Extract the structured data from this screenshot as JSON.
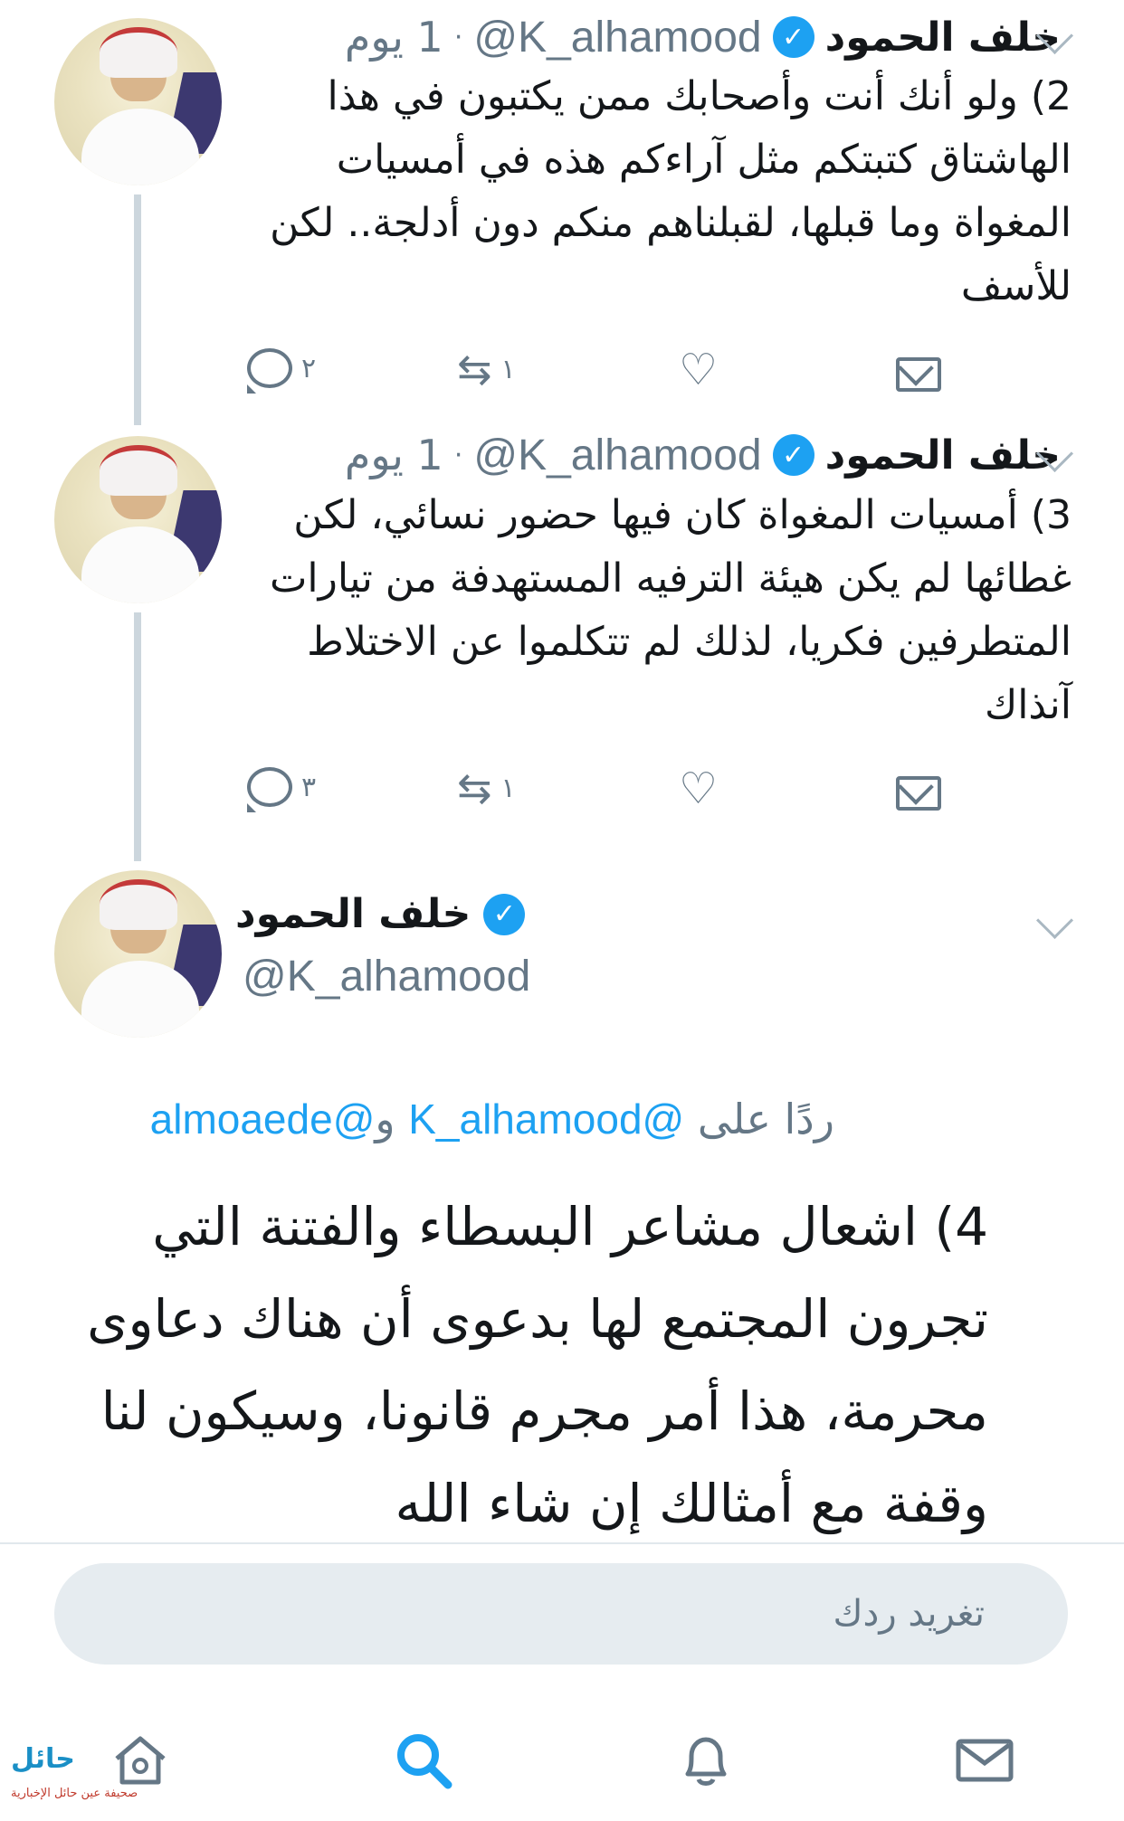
{
  "tweets": [
    {
      "name": "خلف الحمود",
      "handle": "@K_alhamood",
      "time": "1 يوم",
      "text": "2) ولو أنك أنت وأصحابك ممن يكتبون في هذا الهاشتاق كتبتكم مثل آراءكم هذه في أمسيات المغواة وما قبلها، لقبلناهم منكم دون أدلجة.. لكن للأسف",
      "replies": "٢",
      "retweets": "١"
    },
    {
      "name": "خلف الحمود",
      "handle": "@K_alhamood",
      "time": "1 يوم",
      "text": "3) أمسيات المغواة كان فيها حضور نسائي، لكن غطائها لم يكن هيئة الترفيه المستهدفة من تيارات المتطرفين فكريا، لذلك لم تتكلموا عن الاختلاط آنذاك",
      "replies": "٣",
      "retweets": "١"
    }
  ],
  "main_tweet": {
    "name": "خلف الحمود",
    "handle": "@K_alhamood",
    "replying_prefix": "ردًا على",
    "mention1": "@K_alhamood",
    "connector": "و",
    "mention2": "@almoaede",
    "text": "4) اشعال مشاعر البسطاء والفتنة التي تجرون المجتمع لها بدعوى أن هناك دعاوى محرمة، هذا أمر مجرم قانونا، وسيكون لنا وقفة مع أمثالك إن شاء الله"
  },
  "reply_box": {
    "placeholder": "تغريد ردك"
  },
  "watermark": {
    "title": "حائل",
    "subtitle": "صحيفة عين حائل الإخبارية"
  },
  "icons": {
    "verified": "verified-badge-icon",
    "reply": "reply-icon",
    "retweet": "retweet-icon",
    "like": "heart-icon",
    "dm": "mail-icon",
    "tabs": [
      "home-icon",
      "search-icon",
      "bell-icon",
      "mail-icon"
    ]
  },
  "colors": {
    "accent": "#1da1f2",
    "secondary_text": "#657786",
    "line": "#ccd6dd"
  }
}
